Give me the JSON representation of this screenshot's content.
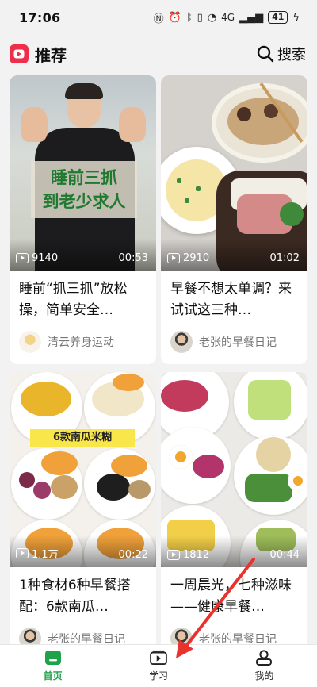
{
  "status_bar": {
    "time": "17:06",
    "network": "4G",
    "battery": "41"
  },
  "header": {
    "title": "推荐",
    "search_label": "搜索"
  },
  "feed": [
    {
      "views": "9140",
      "duration": "00:53",
      "title": "睡前“抓三抓”放松操，简单安全…",
      "author": "清云养身运动",
      "caption_line1": "睡前三抓",
      "caption_line2": "到老少求人"
    },
    {
      "views": "2910",
      "duration": "01:02",
      "title": "早餐不想太单调？来试试这三种…",
      "author": "老张的早餐日记"
    },
    {
      "views": "1.1万",
      "duration": "00:22",
      "title": "1种食材6种早餐搭配：6款南瓜…",
      "author": "老张的早餐日记",
      "banner": "6款南瓜米糊"
    },
    {
      "views": "1812",
      "duration": "00:44",
      "title": "一周晨光，七种滋味——健康早餐…",
      "author": "老张的早餐日记"
    }
  ],
  "bottom_nav": [
    {
      "label": "首页",
      "active": true
    },
    {
      "label": "学习",
      "active": false
    },
    {
      "label": "我的",
      "active": false
    }
  ],
  "colors": {
    "accent": "#1fa34a",
    "logo": "#ee2e4a",
    "annotation_arrow": "#e8322b"
  }
}
